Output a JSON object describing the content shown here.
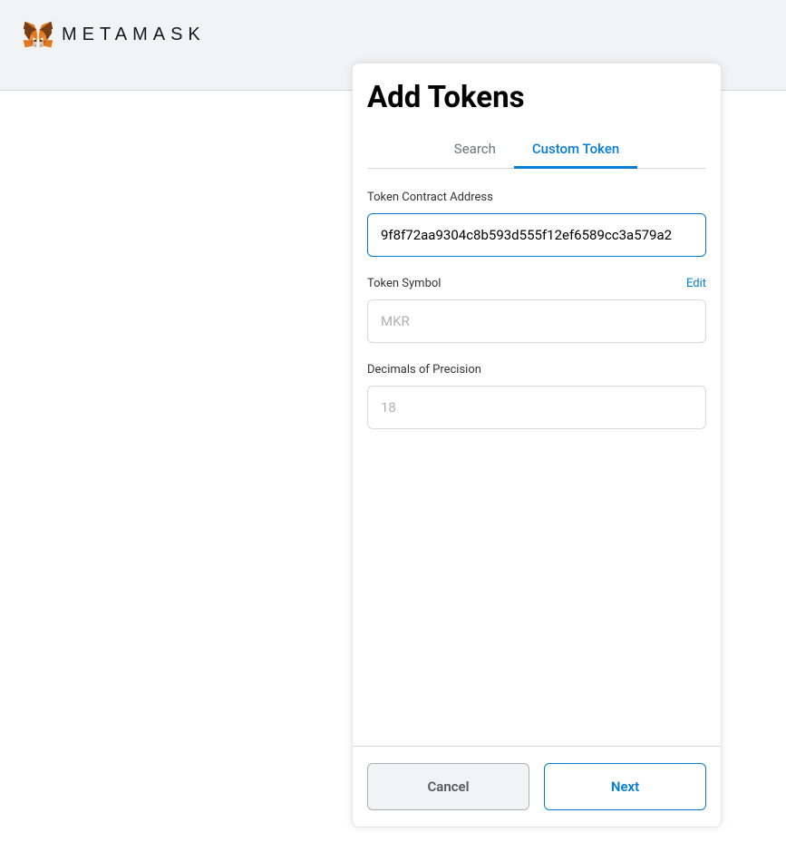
{
  "brand": "METAMASK",
  "modal": {
    "title": "Add Tokens",
    "tabs": {
      "search": "Search",
      "custom": "Custom Token"
    },
    "fields": {
      "address": {
        "label": "Token Contract Address",
        "value": "9f8f72aa9304c8b593d555f12ef6589cc3a579a2"
      },
      "symbol": {
        "label": "Token Symbol",
        "edit": "Edit",
        "value": "MKR"
      },
      "decimals": {
        "label": "Decimals of Precision",
        "value": "18"
      }
    },
    "buttons": {
      "cancel": "Cancel",
      "next": "Next"
    }
  }
}
